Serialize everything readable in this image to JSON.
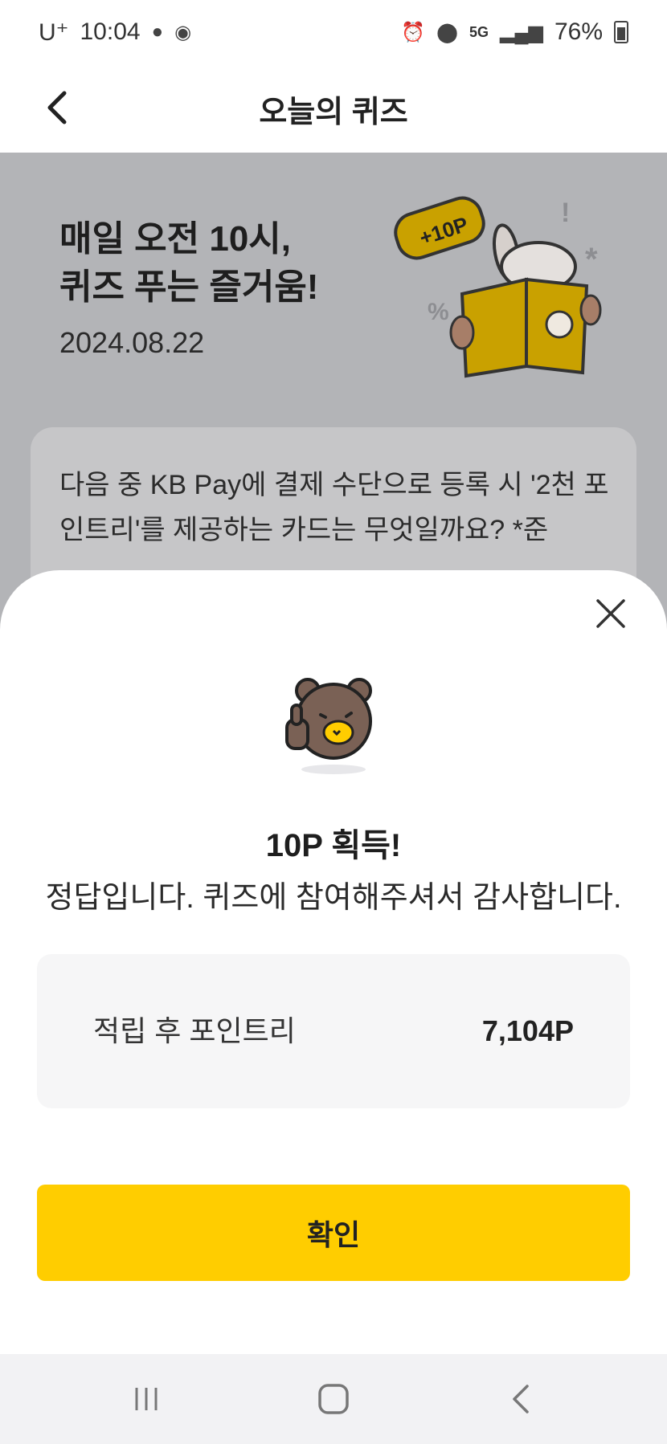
{
  "status_bar": {
    "carrier": "U⁺",
    "time": "10:04",
    "network": "5G",
    "battery": "76%"
  },
  "header": {
    "title": "오늘의 퀴즈"
  },
  "banner": {
    "headline": "매일 오전 10시,\n퀴즈 푸는 즐거움!",
    "date": "2024.08.22",
    "badge": "+10P",
    "question": "다음 중 KB Pay에 결제 수단으로 등록 시 '2천 포인트리'를 제공하는 카드는 무엇일까요? *준"
  },
  "sheet": {
    "title": "10P 획득!",
    "message": "정답입니다. 퀴즈에 참여해주셔서 감사합니다.",
    "points_label": "적립 후 포인트리",
    "points_value": "7,104P",
    "confirm_label": "확인"
  },
  "colors": {
    "accent": "#ffcd00",
    "dim_background": "#b3b4b7",
    "card_background": "#f6f6f7"
  },
  "icons": {
    "back": "chevron-left-icon",
    "close": "close-icon",
    "nav_recents": "recents-icon",
    "nav_home": "home-icon",
    "nav_back": "back-icon"
  }
}
